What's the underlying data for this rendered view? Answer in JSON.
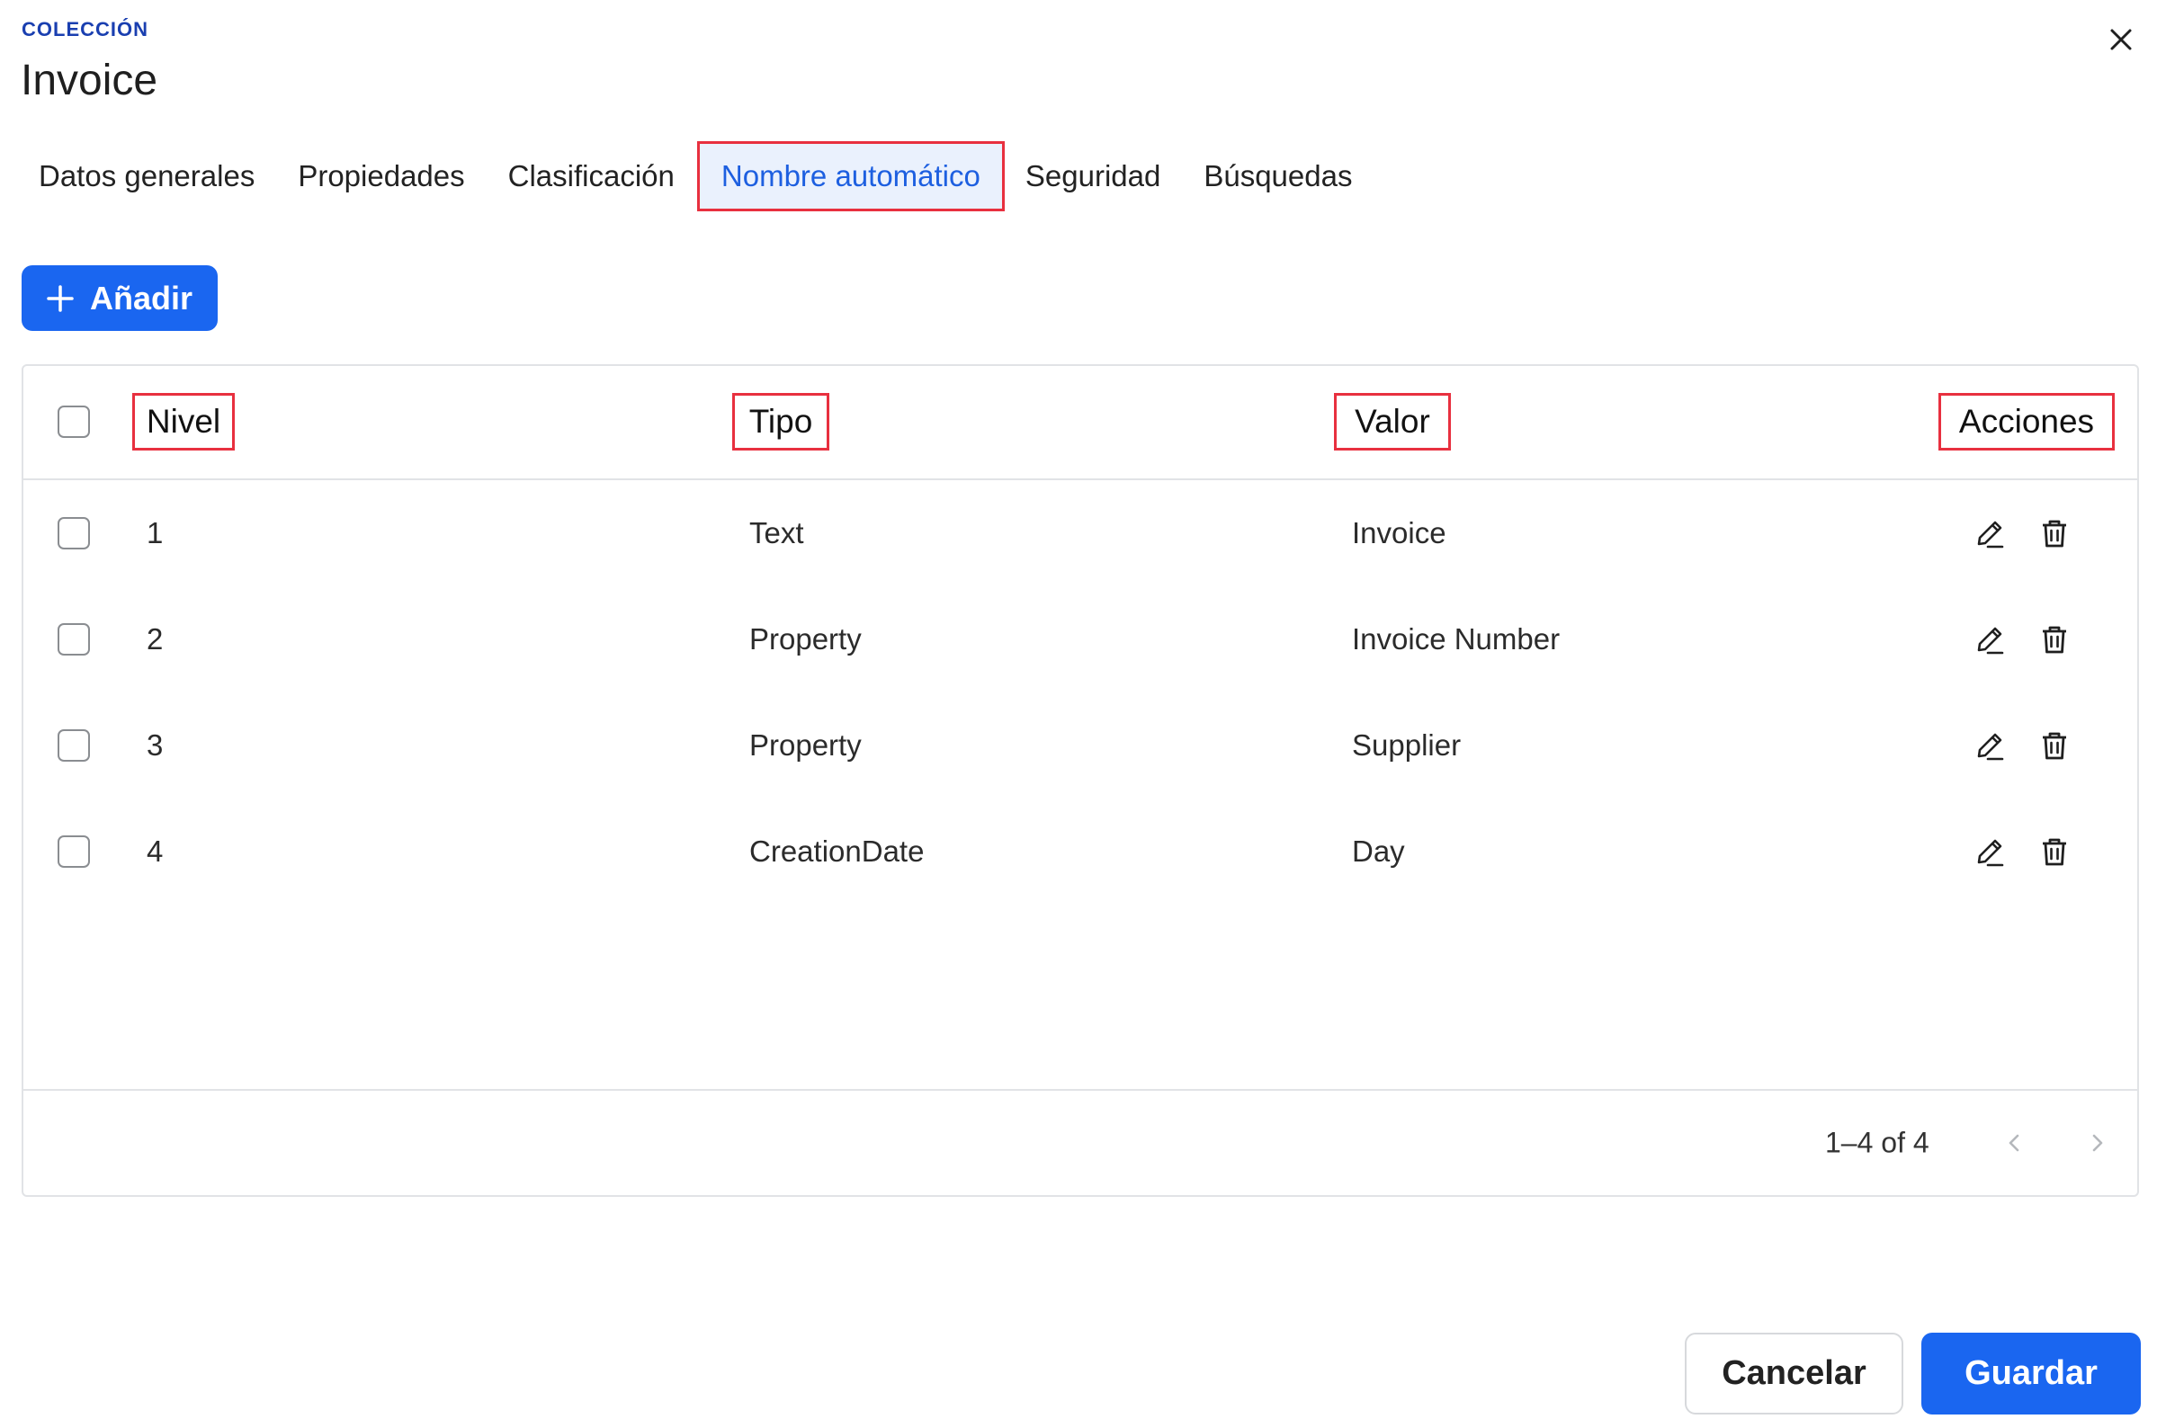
{
  "header": {
    "overline": "COLECCIÓN",
    "title": "Invoice",
    "close_icon": "close-icon"
  },
  "tabs": [
    {
      "label": "Datos generales",
      "active": false
    },
    {
      "label": "Propiedades",
      "active": false
    },
    {
      "label": "Clasificación",
      "active": false
    },
    {
      "label": "Nombre automático",
      "active": true
    },
    {
      "label": "Seguridad",
      "active": false
    },
    {
      "label": "Búsquedas",
      "active": false
    }
  ],
  "toolbar": {
    "add_label": "Añadir",
    "add_icon": "plus-icon"
  },
  "table": {
    "columns": [
      "Nivel",
      "Tipo",
      "Valor",
      "Acciones"
    ],
    "rows": [
      {
        "nivel": "1",
        "tipo": "Text",
        "valor": "Invoice"
      },
      {
        "nivel": "2",
        "tipo": "Property",
        "valor": "Invoice Number"
      },
      {
        "nivel": "3",
        "tipo": "Property",
        "valor": "Supplier"
      },
      {
        "nivel": "4",
        "tipo": "CreationDate",
        "valor": "Day"
      }
    ],
    "row_actions": [
      "edit-icon",
      "trash-icon"
    ]
  },
  "pagination": {
    "range_label": "1–4 of 4"
  },
  "footer": {
    "cancel_label": "Cancelar",
    "save_label": "Guardar"
  },
  "colors": {
    "accent": "#1a66f0",
    "overline": "#1a3fb0",
    "highlight_border": "#e8303f"
  }
}
